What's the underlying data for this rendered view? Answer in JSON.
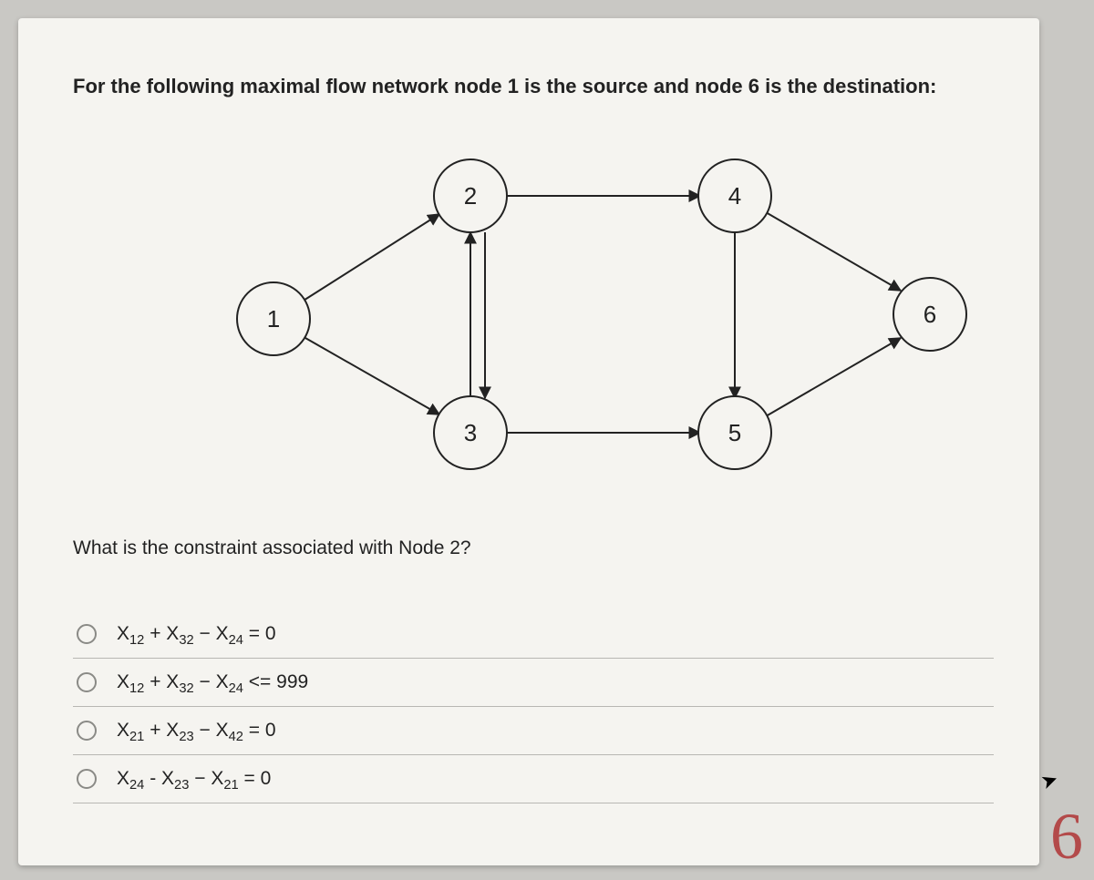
{
  "question": {
    "stem": "For the following maximal flow network node 1 is the source and node 6 is the destination:",
    "sub": "What is the constraint associated with Node 2?"
  },
  "nodes": {
    "n1": "1",
    "n2": "2",
    "n3": "3",
    "n4": "4",
    "n5": "5",
    "n6": "6"
  },
  "options": [
    {
      "var1": "X",
      "sub1": "12",
      "op1": " + ",
      "var2": "X",
      "sub2": "32",
      "op2": " − ",
      "var3": "X",
      "sub3": "24",
      "tail": " = 0"
    },
    {
      "var1": "X",
      "sub1": "12",
      "op1": " + ",
      "var2": "X",
      "sub2": "32",
      "op2": " − ",
      "var3": "X",
      "sub3": "24",
      "tail": " <= 999"
    },
    {
      "var1": "X",
      "sub1": "21",
      "op1": " + ",
      "var2": "X",
      "sub2": "23",
      "op2": " − ",
      "var3": "X",
      "sub3": "42",
      "tail": " = 0"
    },
    {
      "var1": "X",
      "sub1": "24",
      "op1": " - ",
      "var2": "X",
      "sub2": "23",
      "op2": " − ",
      "var3": "X",
      "sub3": "21",
      "tail": " = 0"
    }
  ],
  "page_number": "6"
}
